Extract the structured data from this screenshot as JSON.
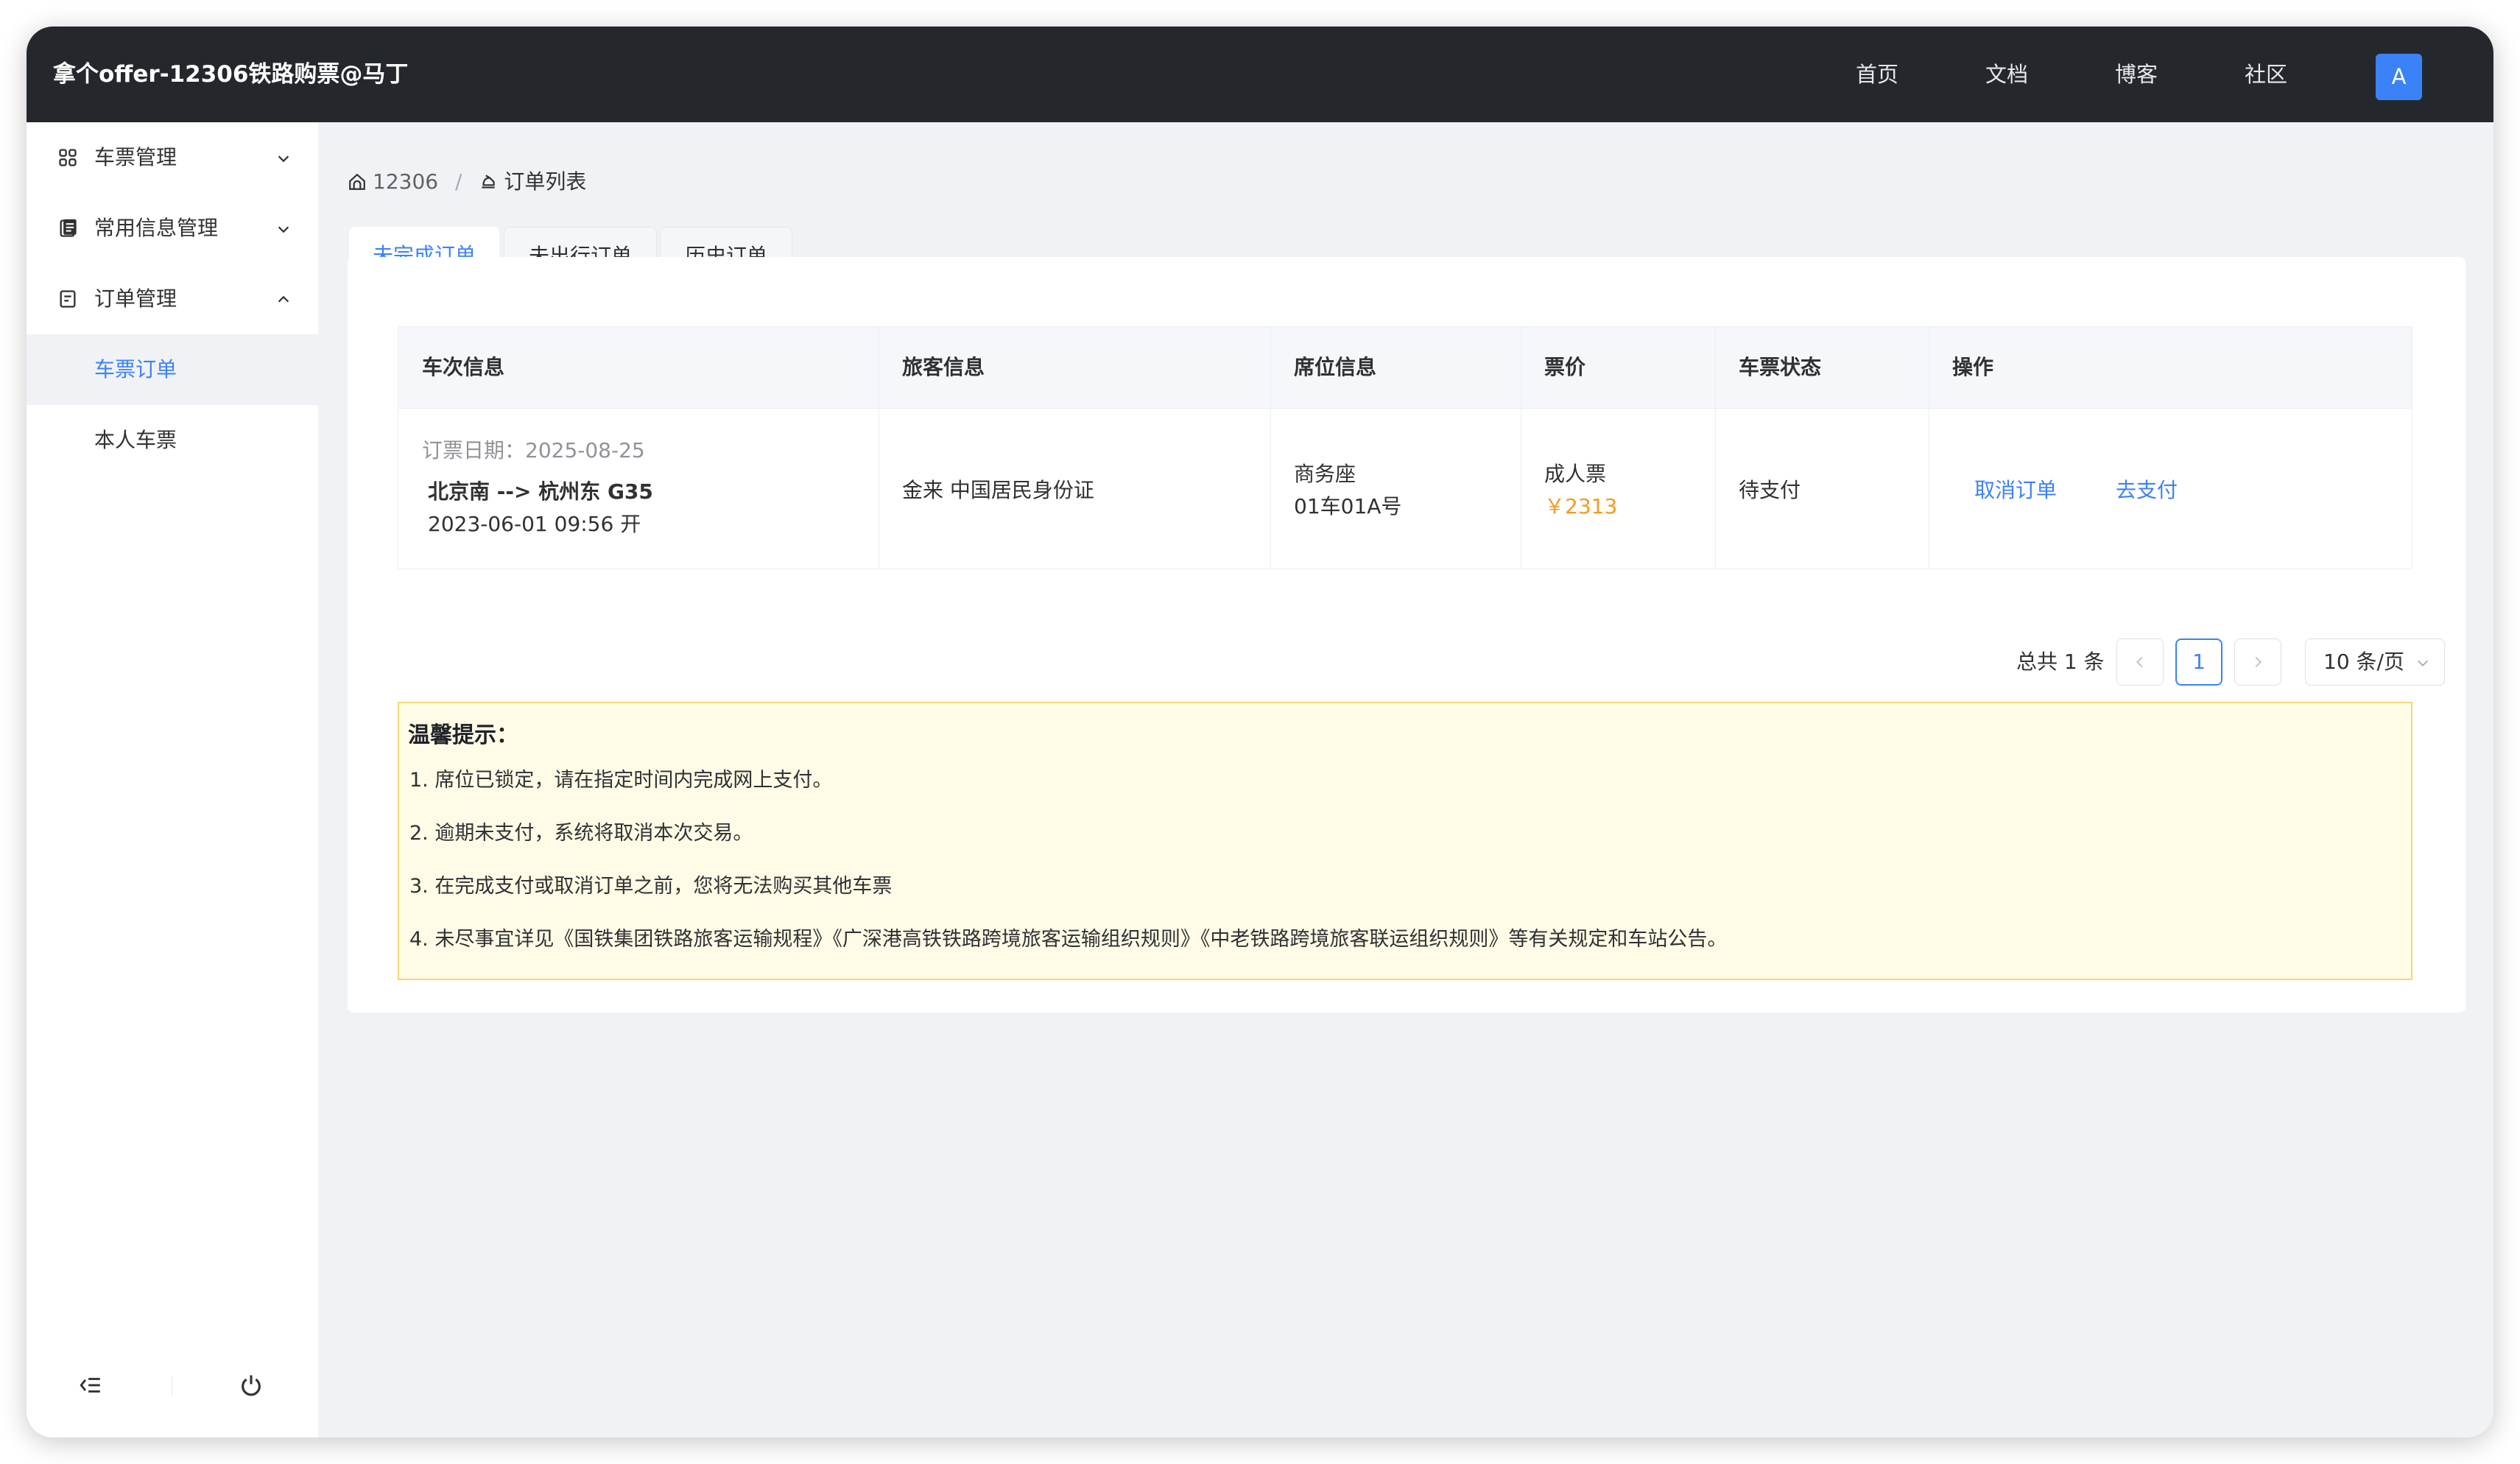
{
  "app": {
    "title": "拿个offer-12306铁路购票@马丁",
    "nav": [
      "首页",
      "文档",
      "博客",
      "社区"
    ],
    "avatar": "A"
  },
  "sidebar": {
    "groups": [
      {
        "label": "车票管理",
        "icon": "ticket-grid-icon",
        "expanded": false
      },
      {
        "label": "常用信息管理",
        "icon": "document-icon",
        "expanded": false
      },
      {
        "label": "订单管理",
        "icon": "order-icon",
        "expanded": true
      }
    ],
    "subitems": [
      {
        "label": "车票订单",
        "active": true
      },
      {
        "label": "本人车票",
        "active": false
      }
    ]
  },
  "breadcrumb": {
    "home": "12306",
    "separator": "/",
    "current": "订单列表"
  },
  "tabs": [
    {
      "label": "未完成订单",
      "active": true
    },
    {
      "label": "未出行订单",
      "active": false
    },
    {
      "label": "历史订单",
      "active": false
    }
  ],
  "table": {
    "headers": [
      "车次信息",
      "旅客信息",
      "席位信息",
      "票价",
      "车票状态",
      "操作"
    ],
    "rows": [
      {
        "order_date": "订票日期：2025-08-25",
        "route": "北京南 --> 杭州东 G35",
        "departure": "2023-06-01 09:56 开",
        "passenger": "金来 中国居民身份证",
        "seat_class": "商务座",
        "seat_no": "01车01A号",
        "ticket_type": "成人票",
        "price": "￥2313",
        "status": "待支付",
        "actions": [
          "取消订单",
          "去支付"
        ]
      }
    ]
  },
  "pagination": {
    "total_text": "总共 1 条",
    "current_page": "1",
    "page_size": "10 条/页"
  },
  "notice": {
    "title": "温馨提示：",
    "lines": [
      "1. 席位已锁定，请在指定时间内完成网上支付。",
      "2. 逾期未支付，系统将取消本次交易。",
      "3. 在完成支付或取消订单之前，您将无法购买其他车票",
      "4. 未尽事宜详见《国铁集团铁路旅客运输规程》《广深港高铁铁路跨境旅客运输组织规则》《中老铁路跨境旅客联运组织规则》等有关规定和车站公告。"
    ]
  },
  "colors": {
    "header_bg": "#24282d",
    "accent": "#3b82f6",
    "price": "#f59a23",
    "notice_bg": "#fffbe6",
    "notice_border": "#f5d874"
  }
}
